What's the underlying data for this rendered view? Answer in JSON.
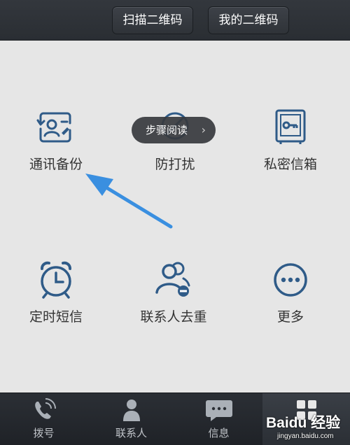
{
  "header": {
    "scan_label": "扫描二维码",
    "my_code_label": "我的二维码"
  },
  "grid": {
    "items": [
      {
        "label": "通讯备份",
        "icon": "contacts-backup-icon"
      },
      {
        "label": "防打扰",
        "icon": "do-not-disturb-icon"
      },
      {
        "label": "私密信箱",
        "icon": "private-safe-icon"
      },
      {
        "label": "定时短信",
        "icon": "alarm-clock-icon"
      },
      {
        "label": "联系人去重",
        "icon": "contacts-dedup-icon"
      },
      {
        "label": "更多",
        "icon": "more-icon"
      }
    ]
  },
  "tooltip": {
    "text": "步骤阅读",
    "chevron": "›"
  },
  "tabs": [
    {
      "label": "拨号",
      "icon": "phone-icon"
    },
    {
      "label": "联系人",
      "icon": "person-icon"
    },
    {
      "label": "信息",
      "icon": "message-icon"
    },
    {
      "label": "",
      "icon": "grid-icon"
    }
  ],
  "watermark": {
    "brand": "Baidu 经验",
    "url": "jingyan.baidu.com"
  },
  "colors": {
    "icon_blue": "#2f5b88",
    "annotation_arrow": "#3a8fe0",
    "topbar": "#2d3136",
    "background": "#e6e6e6"
  }
}
